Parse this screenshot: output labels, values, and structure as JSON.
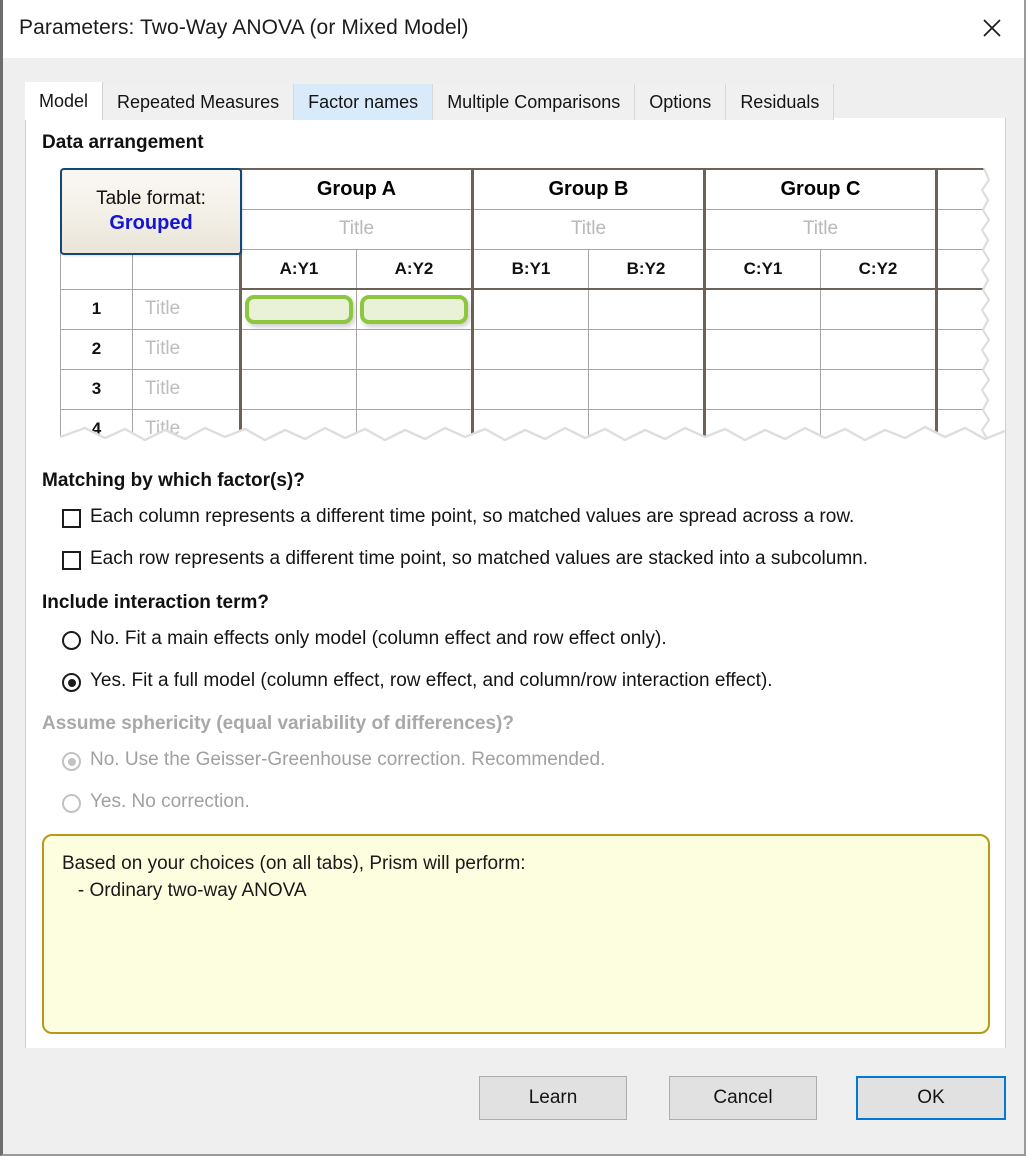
{
  "window": {
    "title": "Parameters: Two-Way ANOVA (or Mixed Model)",
    "close_label": "Close",
    "close_icon": "close-icon"
  },
  "tabs": [
    {
      "label": "Model",
      "state": "active"
    },
    {
      "label": "Repeated Measures",
      "state": "normal"
    },
    {
      "label": "Factor names",
      "state": "hovered"
    },
    {
      "label": "Multiple Comparisons",
      "state": "normal"
    },
    {
      "label": "Options",
      "state": "normal"
    },
    {
      "label": "Residuals",
      "state": "normal"
    }
  ],
  "sections": {
    "data_arrangement": "Data arrangement",
    "matching": "Matching by which factor(s)?",
    "interaction": "Include interaction term?",
    "sphericity": "Assume sphericity (equal variability of differences)?"
  },
  "table_format": {
    "line1": "Table format:",
    "line2": "Grouped"
  },
  "grid": {
    "groups": [
      "Group A",
      "Group B",
      "Group C"
    ],
    "group_title_placeholder": "Title",
    "subcolumns": [
      "A:Y1",
      "A:Y2",
      "B:Y1",
      "B:Y2",
      "C:Y1",
      "C:Y2"
    ],
    "row_numbers": [
      "1",
      "2",
      "3",
      "4"
    ],
    "row_title_placeholder": "Title",
    "selected_cells": [
      "A:Y1",
      "A:Y2"
    ],
    "selection_color": "#8dc63f",
    "selection_fill": "#e9f2d7"
  },
  "matching_options": [
    {
      "label": "Each column represents a different time point, so matched values are spread across a row.",
      "checked": false
    },
    {
      "label": "Each row represents a different time point, so matched values are stacked into a subcolumn.",
      "checked": false
    }
  ],
  "interaction_options": [
    {
      "label": "No. Fit a main effects only model (column effect and row effect only).",
      "checked": false
    },
    {
      "label": "Yes. Fit a full model (column effect, row effect, and column/row interaction effect).",
      "checked": true
    }
  ],
  "sphericity_options": [
    {
      "label": "No. Use the Geisser-Greenhouse correction. Recommended.",
      "checked": true,
      "disabled": true
    },
    {
      "label": "Yes. No correction.",
      "checked": false,
      "disabled": true
    }
  ],
  "summary": {
    "line1": "Based on your choices (on all tabs), Prism will perform:",
    "line2": "   - Ordinary two-way ANOVA"
  },
  "footer": {
    "learn": "Learn",
    "cancel": "Cancel",
    "ok": "OK"
  },
  "colors": {
    "accent_blue": "#0078d7",
    "table_format_border": "#13477a",
    "grouped_text": "#1414d4",
    "summary_bg": "#fdfddf",
    "summary_border": "#b39a18",
    "header_fill": "#ebe8de",
    "tab_hover": "#d9ebfa"
  }
}
